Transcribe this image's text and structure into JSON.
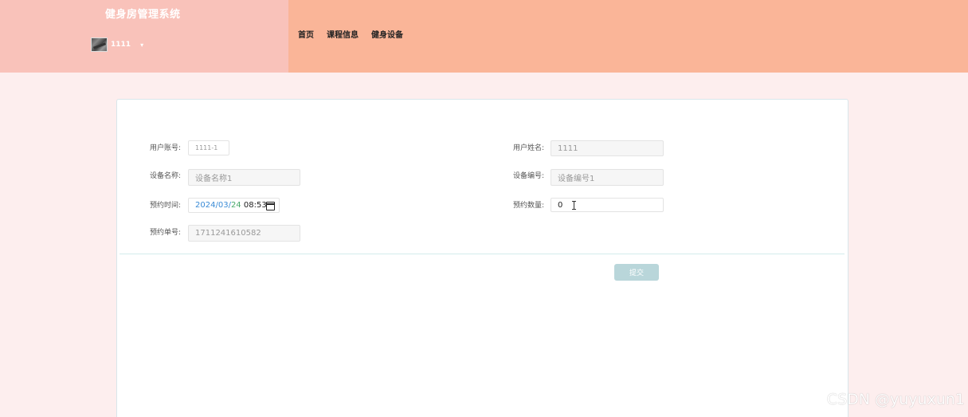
{
  "header": {
    "app_title": "健身房管理系统",
    "username": "1111",
    "caret": "▾",
    "nav": [
      "首页",
      "课程信息",
      "健身设备"
    ]
  },
  "form": {
    "user_account": {
      "label": "用户账号:",
      "value": "1111-1"
    },
    "user_name": {
      "label": "用户姓名:",
      "value": "1111"
    },
    "device_name": {
      "label": "设备名称:",
      "value": "设备名称1"
    },
    "device_code": {
      "label": "设备编号:",
      "value": "设备编号1"
    },
    "booking_time": {
      "label": "预约时间:",
      "year": "2024",
      "month": "03",
      "day": "24",
      "time": "08:53"
    },
    "booking_qty": {
      "label": "预约数量:",
      "value": "0"
    },
    "booking_no": {
      "label": "预约单号:",
      "value": "1711241610582"
    },
    "submit_label": "提交"
  },
  "watermark": "CSDN @yuyuxun1",
  "colors": {
    "header_left": "#f9c2ba",
    "header_right": "#fab598",
    "page_bg": "#fdeeee",
    "submit_bg": "#b9d6da"
  }
}
